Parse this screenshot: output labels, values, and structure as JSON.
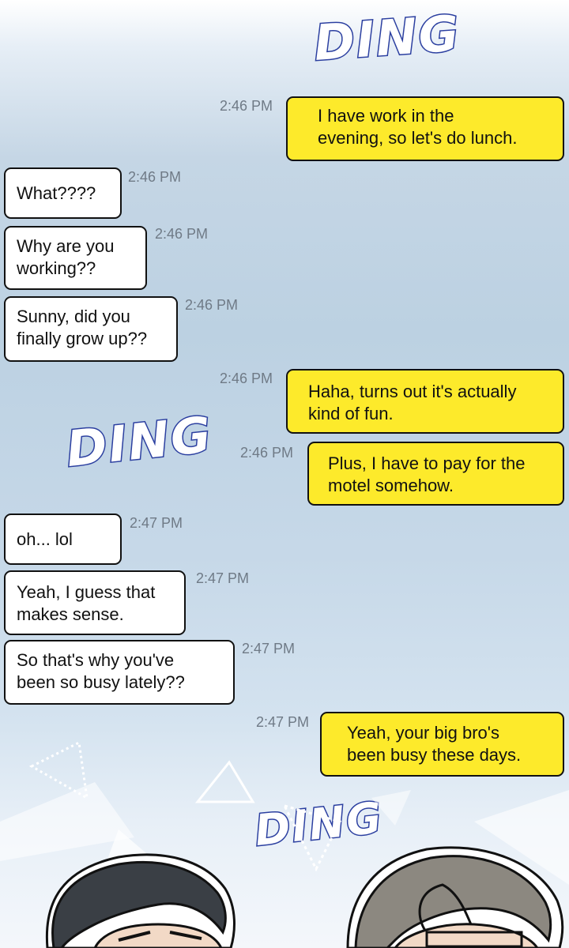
{
  "sfx": [
    "DING",
    "DING",
    "DING"
  ],
  "messages": [
    {
      "side": "out",
      "text": "I have work in the\nevening, so let's do lunch.",
      "time": "2:46 PM"
    },
    {
      "side": "in",
      "text": "What????",
      "time": "2:46 PM"
    },
    {
      "side": "in",
      "text": "Why are you\nworking??",
      "time": "2:46 PM"
    },
    {
      "side": "in",
      "text": "Sunny, did you\nfinally grow up??",
      "time": "2:46 PM"
    },
    {
      "side": "out",
      "text": "Haha, turns out it's actually\nkind of fun.",
      "time": "2:46 PM"
    },
    {
      "side": "out",
      "text": "Plus, I have to pay for the\nmotel somehow.",
      "time": "2:46 PM"
    },
    {
      "side": "in",
      "text": "oh... lol",
      "time": "2:47 PM"
    },
    {
      "side": "in",
      "text": "Yeah, I guess that\nmakes sense.",
      "time": "2:47 PM"
    },
    {
      "side": "in",
      "text": "So that's why you've\nbeen so busy lately??",
      "time": "2:47 PM"
    },
    {
      "side": "out",
      "text": "Yeah, your big bro's\nbeen busy these days.",
      "time": "2:47 PM"
    }
  ],
  "colors": {
    "incoming_bubble": "#ffffff",
    "outgoing_bubble": "#fdea2b",
    "sfx_outline": "#2b3fa0",
    "timestamp": "#6f7a86"
  }
}
